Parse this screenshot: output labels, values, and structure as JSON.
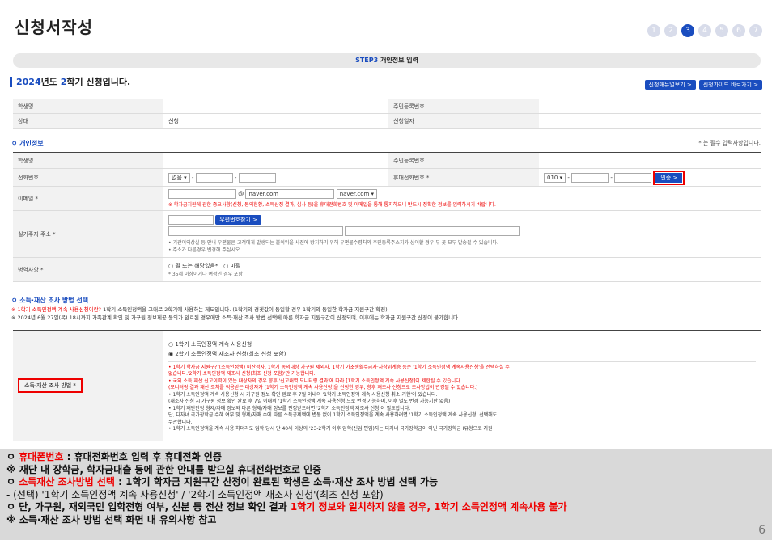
{
  "title": "신청서작성",
  "steps": [
    "1",
    "2",
    "3",
    "4",
    "5",
    "6",
    "7"
  ],
  "step_banner_label": "STEP3",
  "step_banner_text": "개인정보 입력",
  "semester": {
    "year": "2024",
    "mid": "년도 ",
    "num": "2",
    "rest": "학기 신청입니다."
  },
  "top_buttons": [
    "신청매뉴얼보기 >",
    "신청가이드 바로가기 >"
  ],
  "header_table": [
    {
      "l1": "학생명",
      "v1": "",
      "l2": "주민등록번호",
      "v2": ""
    },
    {
      "l1": "상태",
      "v1": "신청",
      "l2": "신청일자",
      "v2": ""
    }
  ],
  "section1": "ㅇ 개인정보",
  "required_note": "* 는 필수 입력사항입니다.",
  "pi": {
    "name_label": "학생명",
    "ssn_label": "주민등록번호",
    "phone_label": "전화번호",
    "phone_select": "없음",
    "mobile_label": "휴대전화번호 *",
    "mobile_select": "010",
    "auth_btn": "인증 >",
    "email_label": "이메일 *",
    "email_at": "@",
    "email_domain": "naver.com",
    "email_select": "naver.com",
    "email_note": "※ 학자금지원에 관한 중요사항(신청, 동의현황, 소득산정 결과, 심사 등)을 휴대전화번호 및 이메일을 통해 통지하오니 반드시 정확한 정보를 입력하시기 바랍니다.",
    "addr_label": "실거주지 주소 *",
    "zip_btn": "우편번호찾기 >",
    "addr_note1": "• 기관이의상실 등 안내 우편물은 고객에게 발생되는 불이익을 사전에 방지하기 위해 우편물수령처와 주민등록주소지가 상이할 경우 두 곳 모두 발송될 수 있습니다.",
    "addr_note2": "• 주소가 다른경우 변경해 주십시오.",
    "mil_label": "병역사항 *",
    "mil_opt1": "필 또는 해당없음*",
    "mil_opt2": "미필",
    "mil_note": "* 35세 이상이거나 여성인 경우 포함"
  },
  "section2": "ㅇ 소득·재산 조사 방법 선택",
  "note_a_red": "※ 1학기 소득인정액 계속 사용신청이란?",
  "note_a": " 1학기 소득인정액을 그대로 2학기에 사용하는 제도입니다. (1학기와 경곗값이 동일할 경우 1학기와 동일한 학자금 지원구간 확정)",
  "note_b": "※ 2024년 6월 27일(목) 18시까지 가족관계 확인 및 가구원 정보제공 동의가 완료된 경우에만 소득·재산 조사 방법 선택에 따른 학자금 지원구간이 산정되며, 이후에는 학자금 지원구간 산정이 불가합니다.",
  "method_label": "소득·재산 조사 방법 *",
  "method_opt1": "1학기 소득인정액 계속 사용신청",
  "method_opt2": "2학기 소득인정액 재조사 신청(최초 신청 포함)",
  "method_notes": [
    {
      "c": "red",
      "t": "• 1학기 학자금 지원구간(소득인정액) 미산정자, 1학기 동의대상 가구원 제외자, 1학기 가초생활수급자·차상위계층 등은 '1학기 소득인정액 계속사용신청'을 선택하실 수"
    },
    {
      "c": "red",
      "t": "  없습니다.'2학기 소득인정액 재조사 신청(최초 신청 포함)'만 가능합니다."
    },
    {
      "c": "red",
      "t": "• 국외 소득·재산 신고이력이 있는 대상자의 경우 향후 '신고내역 모니터링 결과'에 따라 [1학기 소득인정액 계속 사용신청]이 제한될 수 있습니다."
    },
    {
      "c": "red",
      "t": "  (모니터링 결과 재산 조치를 적용받은 대상자가 [1학기 소득인정액 계속 사용신청]을 신청한 경우, 향후 재조사 신청으로 조사방법이 변경될 수 있습니다.)"
    },
    {
      "c": "g",
      "t": "• 1학기 소득인정액 계속 사용신청 시 가구원 정보 확인 완료 후 7일 이내의 '1학기 소득인정액 계속 사용신청 취소 기한'이 있습니다."
    },
    {
      "c": "g",
      "t": "  (재조사 신청 시 가구원 정보 확인 완료 후 7일 이내의 '1학기 소득인정액 계속 사용신청'으로 변경 가능하며, 이후 별도 변경 가능기한 없음)"
    },
    {
      "c": "g",
      "t": "• 1학기 재단인정 형제/자매 정보와 다른 형제/자매 정보를 인정받으려면 '2학기 소득인정액 재조사 신청'이 필요합니다."
    },
    {
      "c": "g",
      "t": "  단, 다자녀 국가장학금 수혜 여부 및 형제/자매 수에 따른 소득공제액에 변동 없이 1학기 소득인정액을 계속 사용하려면 '1학기 소득인정액 계속 사용신청' 선택해도"
    },
    {
      "c": "g",
      "t": "  무관합니다."
    },
    {
      "c": "g",
      "t": "• 1학기 소득인정액을 계속 사용 하더라도 입학 당시 만 40세 이상의 '23-2학기 이후 입학(신입·편입)자는 다자녀 국가장학금이 아닌 국가장학금 Ⅰ유형으로 지원"
    }
  ],
  "bottom": {
    "l1a": "ㅇ ",
    "l1b": "휴대폰번호",
    "l1c": " : 휴대전화번호 입력 후 휴대전화 인증",
    "l2": "※ 재단 내 장학금, 학자금대출 등에 관한 안내를 받으실 휴대전화번호로 인증",
    "l3a": "ㅇ ",
    "l3b": "소득재산 조사방법 선택",
    "l3c": " : 1학기 학자금 지원구간 산정이 완료된 학생은 소득·재산 조사 방법 선택 가능",
    "l4": "- (선택) '1학기 소득인정액 계속 사용신청' / '2학기 소득인정액 재조사 신청'(최초 신청 포함)",
    "l5a": "ㅇ 단, 가구원, 재외국민 입학전형 여부, 신분 등 전산 정보 확인 결과 ",
    "l5b": "1학기 정보와 일치하지 않을 경우, 1학기 소득인정액 계속사용 불가",
    "l6": "※ 소득·재산 조사 방법 선택 화면 내 유의사항 참고",
    "page": "6"
  }
}
